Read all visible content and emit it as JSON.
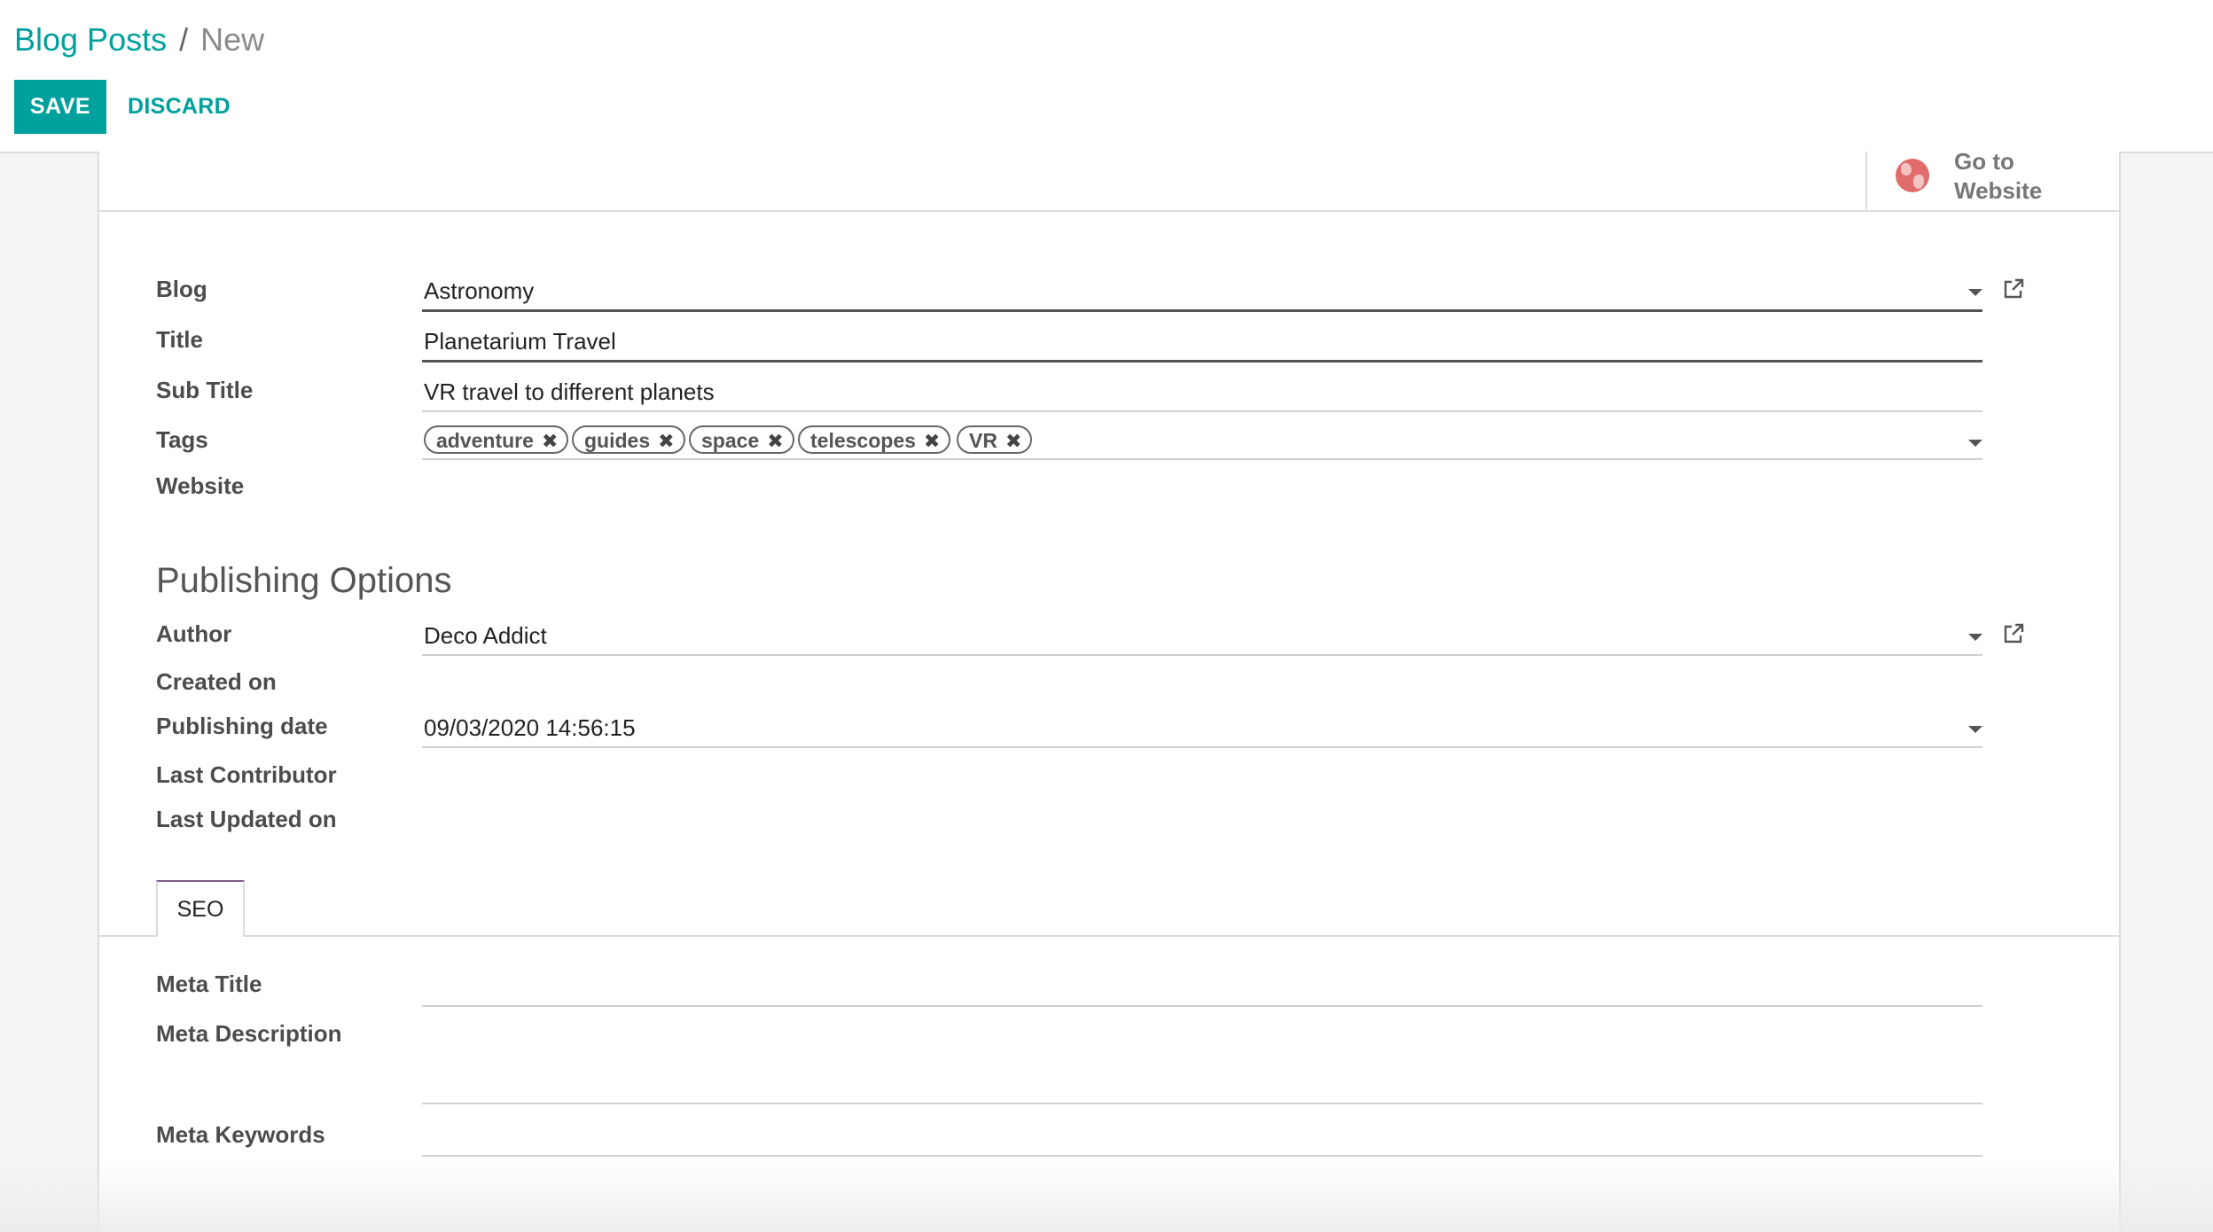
{
  "breadcrumb": {
    "parent": "Blog Posts",
    "separator": "/",
    "current": "New"
  },
  "buttons": {
    "save": "SAVE",
    "discard": "DISCARD"
  },
  "button_box": {
    "goto_line1": "Go to",
    "goto_line2": "Website"
  },
  "fields": {
    "blog": {
      "label": "Blog",
      "value": "Astronomy"
    },
    "title": {
      "label": "Title",
      "value": "Planetarium Travel"
    },
    "subtitle": {
      "label": "Sub Title",
      "value": "VR travel to different planets"
    },
    "tags": {
      "label": "Tags",
      "items": [
        "adventure",
        "guides",
        "space",
        "telescopes",
        "VR"
      ]
    },
    "website": {
      "label": "Website",
      "value": ""
    }
  },
  "publishing": {
    "section_title": "Publishing Options",
    "author": {
      "label": "Author",
      "value": "Deco Addict"
    },
    "created_on": {
      "label": "Created on",
      "value": ""
    },
    "publishing_date": {
      "label": "Publishing date",
      "value": "09/03/2020 14:56:15"
    },
    "last_contributor": {
      "label": "Last Contributor",
      "value": ""
    },
    "last_updated_on": {
      "label": "Last Updated on",
      "value": ""
    }
  },
  "tabs": [
    {
      "label": "SEO",
      "active": true
    }
  ],
  "seo": {
    "meta_title": {
      "label": "Meta Title",
      "value": ""
    },
    "meta_description": {
      "label": "Meta Description",
      "value": ""
    },
    "meta_keywords": {
      "label": "Meta Keywords",
      "value": ""
    }
  },
  "colors": {
    "accent": "#00a09d",
    "tab_accent": "#7c5d8a",
    "globe": "#e06c6c"
  },
  "icons": {
    "external_link": "external-link-icon",
    "dropdown": "caret-down-icon",
    "globe": "globe-icon",
    "remove_tag": "close-icon"
  }
}
